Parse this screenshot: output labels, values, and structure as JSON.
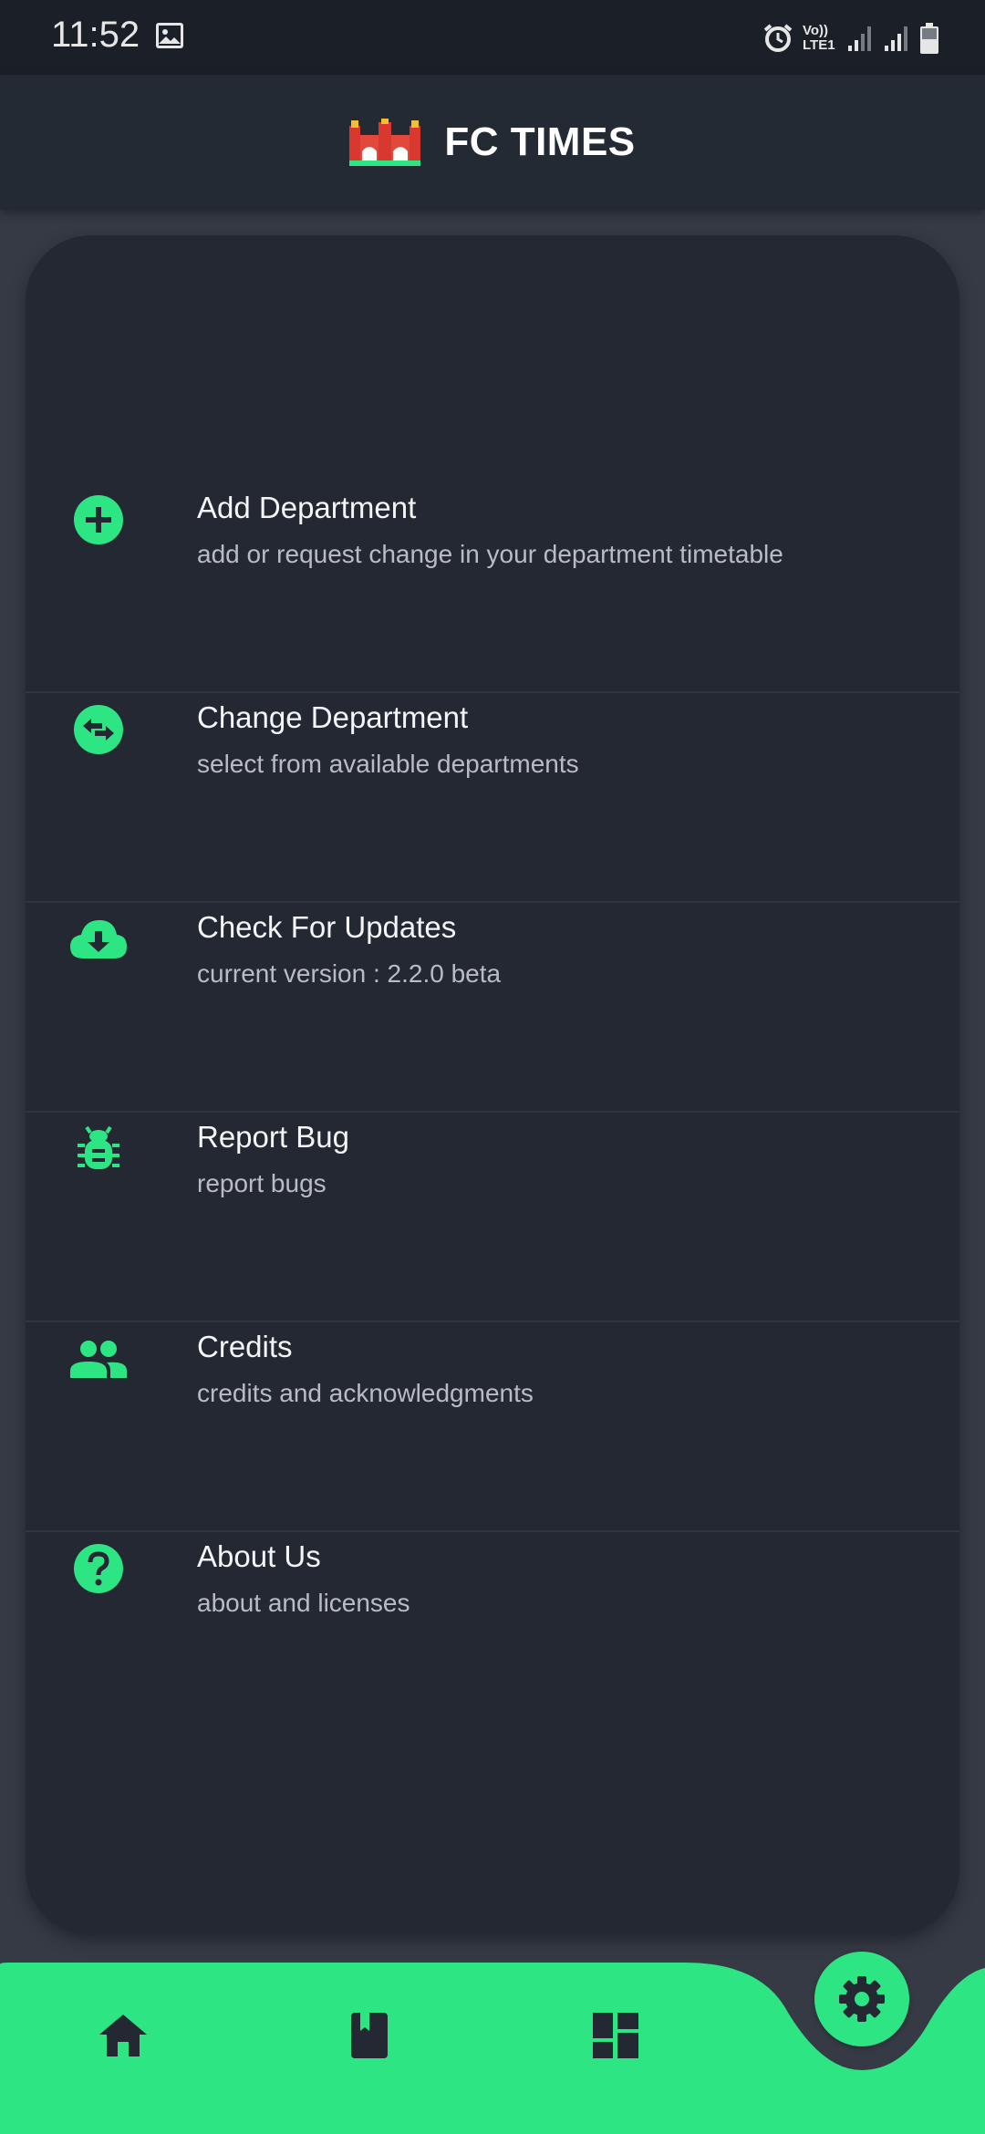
{
  "status_bar": {
    "time": "11:52",
    "network_label": "Vo)) LTE1",
    "icons": [
      "gallery-icon",
      "alarm-icon",
      "signal-icon",
      "signal-icon",
      "battery-icon"
    ]
  },
  "app_bar": {
    "title": "FC TIMES",
    "logo_icon": "gate-logo-icon"
  },
  "menu": {
    "items": [
      {
        "title": "Add Department",
        "subtitle": "add or request change in your department timetable",
        "icon": "add-circle-icon"
      },
      {
        "title": "Change Department",
        "subtitle": "select from available departments",
        "icon": "swap-circle-icon"
      },
      {
        "title": "Check For Updates",
        "subtitle": "current version : 2.2.0 beta",
        "icon": "cloud-download-icon"
      },
      {
        "title": "Report Bug",
        "subtitle": "report bugs",
        "icon": "bug-icon"
      },
      {
        "title": "Credits",
        "subtitle": "credits and acknowledgments",
        "icon": "people-icon"
      },
      {
        "title": "About Us",
        "subtitle": "about and licenses",
        "icon": "help-circle-icon"
      }
    ]
  },
  "bottom_nav": {
    "items": [
      "home-icon",
      "book-icon",
      "dashboard-icon",
      "settings-icon"
    ],
    "active": "settings-icon"
  },
  "colors": {
    "accent": "#2EE584",
    "background": "#353A45",
    "card": "#232833",
    "app_bar": "#242A34",
    "status_bar": "#1B1F27"
  }
}
